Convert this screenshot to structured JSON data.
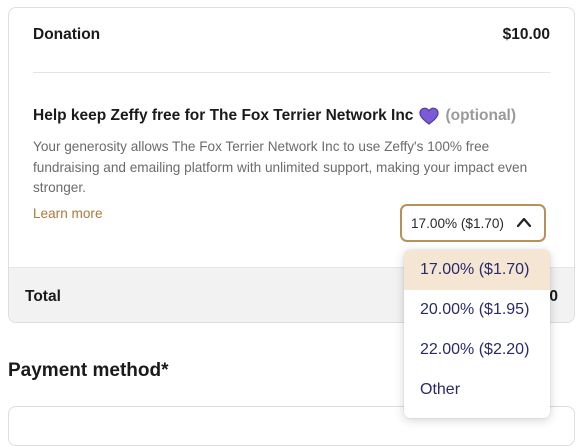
{
  "summary": {
    "donation_label": "Donation",
    "donation_amount": "$10.00",
    "tip_title": "Help keep Zeffy free for The Fox Terrier Network Inc",
    "tip_optional": "(optional)",
    "tip_description": "Your generosity allows The Fox Terrier Network Inc to use Zeffy's 100% free fundraising and emailing platform with unlimited support, making your impact even stronger.",
    "learn_more": "Learn more",
    "tip_selected": "17.00% ($1.70)",
    "total_label": "Total",
    "total_value": "0"
  },
  "tip_options": [
    {
      "label": "17.00% ($1.70)",
      "selected": true
    },
    {
      "label": "20.00% ($1.95)",
      "selected": false
    },
    {
      "label": "22.00% ($2.20)",
      "selected": false
    },
    {
      "label": "Other",
      "selected": false
    }
  ],
  "payment": {
    "heading": "Payment method*"
  },
  "icons": {
    "heart": "purple-heart-icon",
    "chevron": "chevron-up-icon"
  },
  "colors": {
    "heart": "#7b5cd6",
    "accent": "#b89158",
    "link": "#a87a3c",
    "selected_option_bg": "#f5e6d3",
    "option_text": "#2a2a6b"
  }
}
